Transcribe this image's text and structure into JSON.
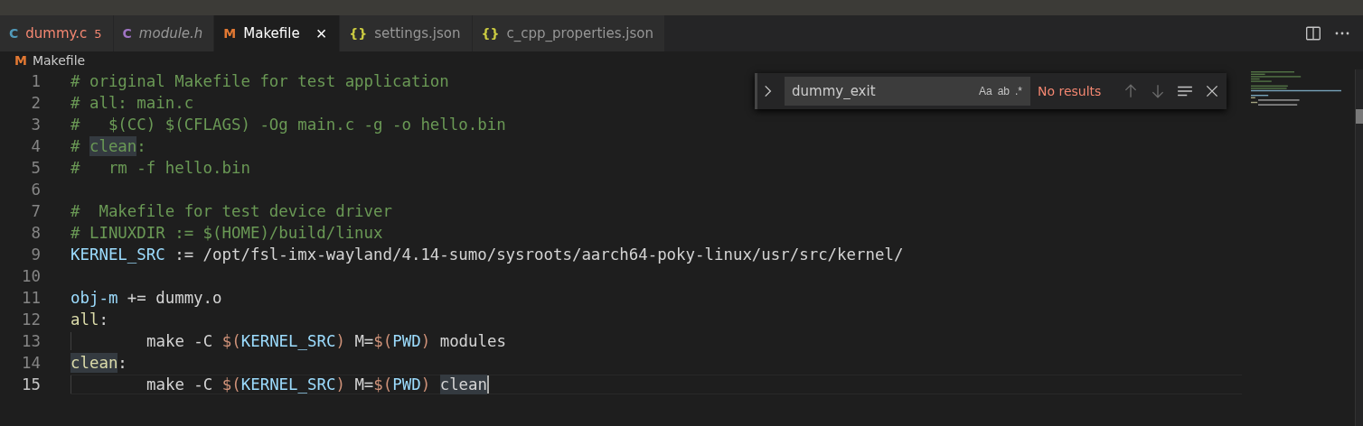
{
  "tabs": [
    {
      "icon": "C",
      "color": "#519aba",
      "label": "dummy.c",
      "italic": false,
      "has_errors": true,
      "error_count": "5",
      "selected": false
    },
    {
      "icon": "C",
      "color": "#a074c4",
      "label": "module.h",
      "italic": true,
      "has_errors": false,
      "selected": false
    },
    {
      "icon": "M",
      "color": "#e37933",
      "label": "Makefile",
      "italic": false,
      "has_errors": false,
      "selected": true,
      "close": "×"
    },
    {
      "icon": "{}",
      "color": "#cbcb41",
      "label": "settings.json",
      "italic": false,
      "has_errors": false,
      "selected": false
    },
    {
      "icon": "{}",
      "color": "#cbcb41",
      "label": "c_cpp_properties.json",
      "italic": false,
      "has_errors": false,
      "selected": false
    }
  ],
  "breadcrumb": {
    "icon": "M",
    "color": "#e37933",
    "label": "Makefile"
  },
  "find": {
    "value": "dummy_exit",
    "options": [
      "Aa",
      "ab",
      ".*"
    ],
    "status": "No results"
  },
  "lines": [
    {
      "number": "1",
      "current": false,
      "tokens": [
        {
          "t": "# original Makefile for test application",
          "kind": "comment",
          "mark": false
        }
      ]
    },
    {
      "number": "2",
      "current": false,
      "tokens": [
        {
          "t": "# all: main.c",
          "kind": "comment",
          "mark": false
        }
      ]
    },
    {
      "number": "3",
      "current": false,
      "tokens": [
        {
          "t": "#   $(CC) $(CFLAGS) -Og main.c -g -o hello.bin",
          "kind": "comment",
          "mark": false
        }
      ]
    },
    {
      "number": "4",
      "current": false,
      "tokens": [
        {
          "t": "# ",
          "kind": "comment",
          "mark": false
        },
        {
          "t": "clean",
          "kind": "comment",
          "mark": true
        },
        {
          "t": ":",
          "kind": "comment",
          "mark": false
        }
      ]
    },
    {
      "number": "5",
      "current": false,
      "tokens": [
        {
          "t": "#   rm -f hello.bin",
          "kind": "comment",
          "mark": false
        }
      ]
    },
    {
      "number": "6",
      "current": false
    },
    {
      "number": "7",
      "current": false,
      "tokens": [
        {
          "t": "#  Makefile for test device driver",
          "kind": "comment",
          "mark": false
        }
      ]
    },
    {
      "number": "8",
      "current": false,
      "tokens": [
        {
          "t": "# LINUXDIR := $(HOME)/build/linux",
          "kind": "comment",
          "mark": false
        }
      ]
    },
    {
      "number": "9",
      "current": false,
      "tokens": [
        {
          "t": "KERNEL_SRC",
          "kind": "name",
          "mark": false
        },
        {
          "t": " := /opt/fsl-imx-wayland/4.14-sumo/sysroots/aarch64-poky-linux/usr/src/kernel/",
          "kind": "plain",
          "mark": false
        }
      ]
    },
    {
      "number": "10",
      "current": false
    },
    {
      "number": "11",
      "current": false,
      "tokens": [
        {
          "t": "obj-m",
          "kind": "name",
          "mark": false
        },
        {
          "t": " += dummy.o",
          "kind": "plain",
          "mark": false
        }
      ]
    },
    {
      "number": "12",
      "current": false,
      "tokens": [
        {
          "t": "all",
          "kind": "target",
          "mark": false
        },
        {
          "t": ":",
          "kind": "plain",
          "mark": false
        }
      ]
    },
    {
      "number": "13",
      "current": false,
      "indent": true,
      "tokens": [
        {
          "t": "make -C ",
          "kind": "plain",
          "mark": false
        },
        {
          "t": "$(",
          "kind": "dollar",
          "mark": false
        },
        {
          "t": "KERNEL_SRC",
          "kind": "name",
          "mark": false
        },
        {
          "t": ")",
          "kind": "dollar",
          "mark": false
        },
        {
          "t": " M=",
          "kind": "plain",
          "mark": false
        },
        {
          "t": "$(",
          "kind": "dollar",
          "mark": false
        },
        {
          "t": "PWD",
          "kind": "name",
          "mark": false
        },
        {
          "t": ")",
          "kind": "dollar",
          "mark": false
        },
        {
          "t": " modules",
          "kind": "plain",
          "mark": false
        }
      ]
    },
    {
      "number": "14",
      "current": false,
      "tokens": [
        {
          "t": "clean",
          "kind": "target",
          "mark": true
        },
        {
          "t": ":",
          "kind": "plain",
          "mark": false
        }
      ]
    },
    {
      "number": "15",
      "current": true,
      "indent": true,
      "tokens": [
        {
          "t": "make -C ",
          "kind": "plain",
          "mark": false
        },
        {
          "t": "$(",
          "kind": "dollar",
          "mark": false
        },
        {
          "t": "KERNEL_SRC",
          "kind": "name",
          "mark": false
        },
        {
          "t": ")",
          "kind": "dollar",
          "mark": false
        },
        {
          "t": " M=",
          "kind": "plain",
          "mark": false
        },
        {
          "t": "$(",
          "kind": "dollar",
          "mark": false
        },
        {
          "t": "PWD",
          "kind": "name",
          "mark": false
        },
        {
          "t": ") ",
          "kind": "dollar",
          "mark": false
        },
        {
          "t": "clean",
          "kind": "plain",
          "mark": true
        }
      ]
    }
  ]
}
